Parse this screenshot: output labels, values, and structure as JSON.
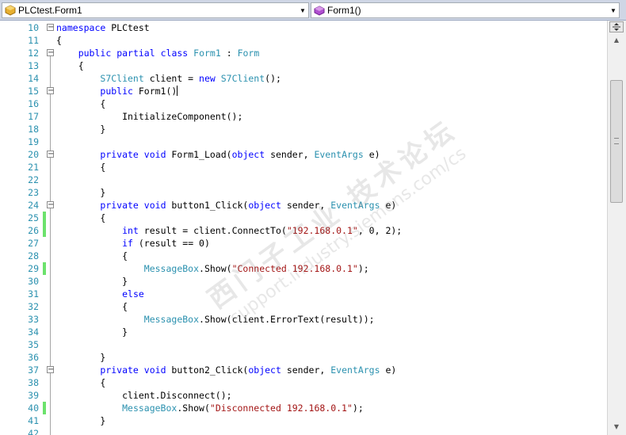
{
  "navigation": {
    "type_combo": {
      "value": "PLCtest.Form1",
      "icon": "class-icon",
      "icon_color": "#d8a020"
    },
    "member_combo": {
      "value": "Form1()",
      "icon": "method-icon",
      "icon_color": "#a040c0"
    }
  },
  "editor": {
    "lines": [
      {
        "num": "10",
        "fold": "minus",
        "tokens": [
          {
            "t": "namespace",
            "c": "kw"
          },
          {
            "t": " PLCtest"
          }
        ]
      },
      {
        "num": "11",
        "tokens": [
          {
            "t": "{"
          }
        ]
      },
      {
        "num": "12",
        "fold": "minus",
        "tokens": [
          {
            "t": "    "
          },
          {
            "t": "public",
            "c": "kw"
          },
          {
            "t": " "
          },
          {
            "t": "partial",
            "c": "kw"
          },
          {
            "t": " "
          },
          {
            "t": "class",
            "c": "kw"
          },
          {
            "t": " "
          },
          {
            "t": "Form1",
            "c": "ty"
          },
          {
            "t": " : "
          },
          {
            "t": "Form",
            "c": "ty"
          }
        ]
      },
      {
        "num": "13",
        "tokens": [
          {
            "t": "    {"
          }
        ]
      },
      {
        "num": "14",
        "tokens": [
          {
            "t": "        "
          },
          {
            "t": "S7Client",
            "c": "ty"
          },
          {
            "t": " client = "
          },
          {
            "t": "new",
            "c": "kw"
          },
          {
            "t": " "
          },
          {
            "t": "S7Client",
            "c": "ty"
          },
          {
            "t": "();"
          }
        ]
      },
      {
        "num": "15",
        "fold": "minus",
        "tokens": [
          {
            "t": "        "
          },
          {
            "t": "public",
            "c": "kw"
          },
          {
            "t": " Form1()"
          }
        ],
        "caret": true
      },
      {
        "num": "16",
        "tokens": [
          {
            "t": "        {"
          }
        ]
      },
      {
        "num": "17",
        "tokens": [
          {
            "t": "            InitializeComponent();"
          }
        ]
      },
      {
        "num": "18",
        "tokens": [
          {
            "t": "        }"
          }
        ]
      },
      {
        "num": "19",
        "tokens": []
      },
      {
        "num": "20",
        "fold": "minus",
        "tokens": [
          {
            "t": "        "
          },
          {
            "t": "private",
            "c": "kw"
          },
          {
            "t": " "
          },
          {
            "t": "void",
            "c": "kw"
          },
          {
            "t": " Form1_Load("
          },
          {
            "t": "object",
            "c": "kw"
          },
          {
            "t": " sender, "
          },
          {
            "t": "EventArgs",
            "c": "ty"
          },
          {
            "t": " e)"
          }
        ]
      },
      {
        "num": "21",
        "tokens": [
          {
            "t": "        {"
          }
        ]
      },
      {
        "num": "22",
        "tokens": []
      },
      {
        "num": "23",
        "tokens": [
          {
            "t": "        }"
          }
        ]
      },
      {
        "num": "24",
        "fold": "minus",
        "tokens": [
          {
            "t": "        "
          },
          {
            "t": "private",
            "c": "kw"
          },
          {
            "t": " "
          },
          {
            "t": "void",
            "c": "kw"
          },
          {
            "t": " button1_Click("
          },
          {
            "t": "object",
            "c": "kw"
          },
          {
            "t": " sender, "
          },
          {
            "t": "EventArgs",
            "c": "ty"
          },
          {
            "t": " e)"
          }
        ]
      },
      {
        "num": "25",
        "changed": true,
        "tokens": [
          {
            "t": "        {"
          }
        ]
      },
      {
        "num": "26",
        "changed": true,
        "tokens": [
          {
            "t": "            "
          },
          {
            "t": "int",
            "c": "kw"
          },
          {
            "t": " result = client.ConnectTo("
          },
          {
            "t": "\"192.168.0.1\"",
            "c": "st"
          },
          {
            "t": ", 0, 2);"
          }
        ]
      },
      {
        "num": "27",
        "tokens": [
          {
            "t": "            "
          },
          {
            "t": "if",
            "c": "kw"
          },
          {
            "t": " (result == 0)"
          }
        ]
      },
      {
        "num": "28",
        "tokens": [
          {
            "t": "            {"
          }
        ]
      },
      {
        "num": "29",
        "changed": true,
        "tokens": [
          {
            "t": "                "
          },
          {
            "t": "MessageBox",
            "c": "ty"
          },
          {
            "t": ".Show("
          },
          {
            "t": "\"Connected 192.168.0.1\"",
            "c": "st"
          },
          {
            "t": ");"
          }
        ]
      },
      {
        "num": "30",
        "tokens": [
          {
            "t": "            }"
          }
        ]
      },
      {
        "num": "31",
        "tokens": [
          {
            "t": "            "
          },
          {
            "t": "else",
            "c": "kw"
          }
        ]
      },
      {
        "num": "32",
        "tokens": [
          {
            "t": "            {"
          }
        ]
      },
      {
        "num": "33",
        "tokens": [
          {
            "t": "                "
          },
          {
            "t": "MessageBox",
            "c": "ty"
          },
          {
            "t": ".Show(client.ErrorText(result));"
          }
        ]
      },
      {
        "num": "34",
        "tokens": [
          {
            "t": "            }"
          }
        ]
      },
      {
        "num": "35",
        "tokens": []
      },
      {
        "num": "36",
        "tokens": [
          {
            "t": "        }"
          }
        ]
      },
      {
        "num": "37",
        "fold": "minus",
        "tokens": [
          {
            "t": "        "
          },
          {
            "t": "private",
            "c": "kw"
          },
          {
            "t": " "
          },
          {
            "t": "void",
            "c": "kw"
          },
          {
            "t": " button2_Click("
          },
          {
            "t": "object",
            "c": "kw"
          },
          {
            "t": " sender, "
          },
          {
            "t": "EventArgs",
            "c": "ty"
          },
          {
            "t": " e)"
          }
        ]
      },
      {
        "num": "38",
        "tokens": [
          {
            "t": "        {"
          }
        ]
      },
      {
        "num": "39",
        "tokens": [
          {
            "t": "            client.Disconnect();"
          }
        ]
      },
      {
        "num": "40",
        "changed": true,
        "tokens": [
          {
            "t": "            "
          },
          {
            "t": "MessageBox",
            "c": "ty"
          },
          {
            "t": ".Show("
          },
          {
            "t": "\"Disconnected 192.168.0.1\"",
            "c": "st"
          },
          {
            "t": ");"
          }
        ]
      },
      {
        "num": "41",
        "tokens": [
          {
            "t": "        }"
          }
        ]
      },
      {
        "num": "42",
        "tokens": []
      }
    ]
  },
  "watermark": {
    "cn": "西门子工业 技术论坛",
    "url": "support.industry.siemens.com/cs"
  },
  "colors": {
    "keyword": "#0000ff",
    "type": "#2b91af",
    "string": "#a31515",
    "line_number": "#2b91af",
    "change_marker": "#6ce26c"
  }
}
